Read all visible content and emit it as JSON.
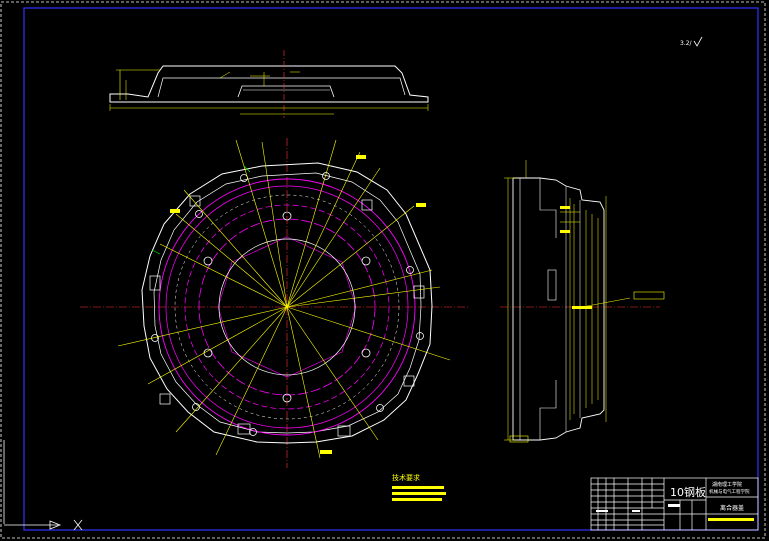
{
  "drawing": {
    "roughness_note": "3.2/",
    "notes_title": "技术要求",
    "colors": {
      "background": "#000000",
      "outline": "#ffffff",
      "part": "#ffffff",
      "center": "#ff0000",
      "dim": "#ffff00",
      "hidden": "#ff00ff",
      "aux": "#00ff00",
      "border": "#0000ff",
      "cyan": "#00ffff"
    }
  },
  "title_block": {
    "material": "10钢板",
    "school_line1": "湖南理工学院",
    "school_line2": "机械与电气工程学院",
    "part_name": "离合器盖"
  }
}
